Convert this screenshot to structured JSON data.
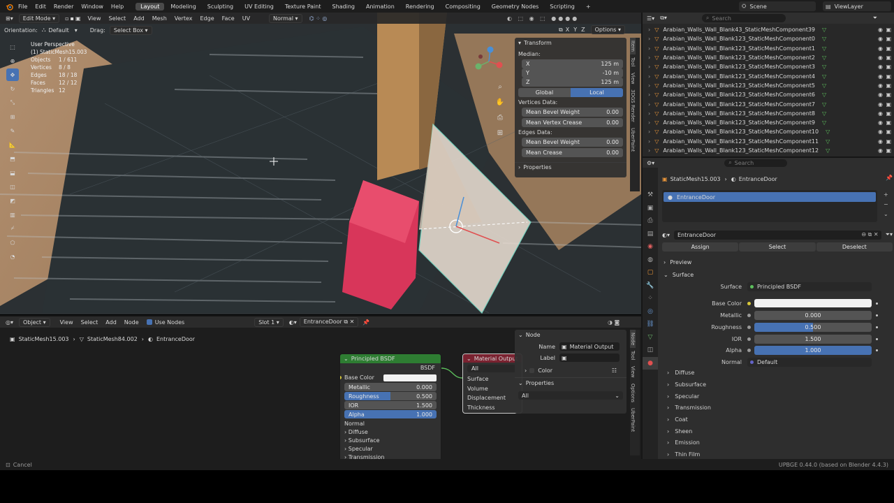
{
  "topbar": {
    "menus": [
      "File",
      "Edit",
      "Render",
      "Window",
      "Help"
    ],
    "workspaces": [
      "Layout",
      "Modeling",
      "Sculpting",
      "UV Editing",
      "Texture Paint",
      "Shading",
      "Animation",
      "Rendering",
      "Compositing",
      "Geometry Nodes",
      "Scripting"
    ],
    "active_workspace": "Layout",
    "add_tab": "+",
    "scene": "Scene",
    "view_layer": "ViewLayer"
  },
  "viewport_header": {
    "mode": "Edit Mode",
    "menus": [
      "View",
      "Select",
      "Add",
      "Mesh",
      "Vertex",
      "Edge",
      "Face",
      "UV"
    ],
    "orientation": "Normal",
    "options": "Options",
    "axes": [
      "X",
      "Y",
      "Z"
    ]
  },
  "tool_settings": {
    "orientation_label": "Orientation:",
    "orientation_value": "Default",
    "drag_label": "Drag:",
    "drag_value": "Select Box"
  },
  "overlay_stats": {
    "view": "User Perspective",
    "object": "(1) StaticMesh15.003",
    "rows": [
      {
        "label": "Objects",
        "value": "1 / 611"
      },
      {
        "label": "Vertices",
        "value": "8 / 8"
      },
      {
        "label": "Edges",
        "value": "18 / 18"
      },
      {
        "label": "Faces",
        "value": "12 / 12"
      },
      {
        "label": "Triangles",
        "value": "12"
      }
    ]
  },
  "transform_panel": {
    "title": "Transform",
    "median_label": "Median:",
    "x_label": "X",
    "x_value": "125 m",
    "y_label": "Y",
    "y_value": "-10 m",
    "z_label": "Z",
    "z_value": "125 m",
    "global": "Global",
    "local": "Local",
    "vertices_data": "Vertices Data:",
    "mean_bevel_weight_label": "Mean Bevel Weight",
    "mean_bevel_weight_value": "0.00",
    "mean_vertex_crease_label": "Mean Vertex Crease",
    "mean_vertex_crease_value": "0.00",
    "edges_data": "Edges Data:",
    "edge_bevel_label": "Mean Bevel Weight",
    "edge_bevel_value": "0.00",
    "mean_crease_label": "Mean Crease",
    "mean_crease_value": "0.00",
    "properties": "Properties"
  },
  "viewport_side_tabs": [
    "Item",
    "Tool",
    "View",
    "3DGS Render",
    "UberPaint"
  ],
  "outliner": {
    "search_placeholder": "Search",
    "items": [
      "Arabian_Walls_Wall_Blank43_StaticMeshComponent39",
      "Arabian_Walls_Wall_Blank123_StaticMeshComponent0",
      "Arabian_Walls_Wall_Blank123_StaticMeshComponent1",
      "Arabian_Walls_Wall_Blank123_StaticMeshComponent2",
      "Arabian_Walls_Wall_Blank123_StaticMeshComponent3",
      "Arabian_Walls_Wall_Blank123_StaticMeshComponent4",
      "Arabian_Walls_Wall_Blank123_StaticMeshComponent5",
      "Arabian_Walls_Wall_Blank123_StaticMeshComponent6",
      "Arabian_Walls_Wall_Blank123_StaticMeshComponent7",
      "Arabian_Walls_Wall_Blank123_StaticMeshComponent8",
      "Arabian_Walls_Wall_Blank123_StaticMeshComponent9",
      "Arabian_Walls_Wall_Blank123_StaticMeshComponent10",
      "Arabian_Walls_Wall_Blank123_StaticMeshComponent11",
      "Arabian_Walls_Wall_Blank123_StaticMeshComponent12"
    ]
  },
  "properties": {
    "search_placeholder": "Search",
    "breadcrumb_object": "StaticMesh15.003",
    "breadcrumb_material": "EntranceDoor",
    "slot_name": "EntranceDoor",
    "material_name": "EntranceDoor",
    "assign": "Assign",
    "select": "Select",
    "deselect": "Deselect",
    "preview": "Preview",
    "surface": "Surface",
    "surface_label": "Surface",
    "surface_value": "Principled BSDF",
    "base_color_label": "Base Color",
    "metallic_label": "Metallic",
    "metallic_value": "0.000",
    "roughness_label": "Roughness",
    "roughness_value": "0.500",
    "roughness_fill": 0.5,
    "ior_label": "IOR",
    "ior_value": "1.500",
    "alpha_label": "Alpha",
    "alpha_value": "1.000",
    "alpha_fill": 1.0,
    "normal_label": "Normal",
    "normal_value": "Default",
    "subpanels": [
      "Diffuse",
      "Subsurface",
      "Specular",
      "Transmission",
      "Coat",
      "Sheen",
      "Emission",
      "Thin Film"
    ]
  },
  "node_editor_header": {
    "type": "Object",
    "menus": [
      "View",
      "Select",
      "Add",
      "Node"
    ],
    "use_nodes": "Use Nodes",
    "slot": "Slot 1",
    "material": "EntranceDoor"
  },
  "node_breadcrumb": {
    "mesh": "StaticMesh15.003",
    "data": "StaticMesh84.002",
    "material": "EntranceDoor"
  },
  "principled_node": {
    "title": "Principled BSDF",
    "output": "BSDF",
    "base_color": "Base Color",
    "metallic_label": "Metallic",
    "metallic_value": "0.000",
    "roughness_label": "Roughness",
    "roughness_value": "0.500",
    "ior_label": "IOR",
    "ior_value": "1.500",
    "alpha_label": "Alpha",
    "alpha_value": "1.000",
    "normal": "Normal",
    "subpanels": [
      "Diffuse",
      "Subsurface",
      "Specular",
      "Transmission"
    ]
  },
  "output_node": {
    "title": "Material Output",
    "target": "All",
    "inputs": [
      "Surface",
      "Volume",
      "Displacement",
      "Thickness"
    ]
  },
  "node_panel": {
    "title": "Node",
    "name_label": "Name",
    "name_value": "Material Output",
    "label_label": "Label",
    "label_value": "",
    "color": "Color",
    "properties": "Properties",
    "properties_value": "All"
  },
  "node_side_tabs": [
    "Node",
    "Tool",
    "View",
    "Options",
    "UberPaint"
  ],
  "statusbar": {
    "left": "Cancel",
    "right": "UPBGE 0.44.0 (based on Blender 4.4.3)"
  },
  "colors": {
    "accent": "#4772b3",
    "panel": "#303030",
    "node_green": "#2e7d32",
    "node_red": "#7a2230",
    "cube": "#d8365a"
  }
}
